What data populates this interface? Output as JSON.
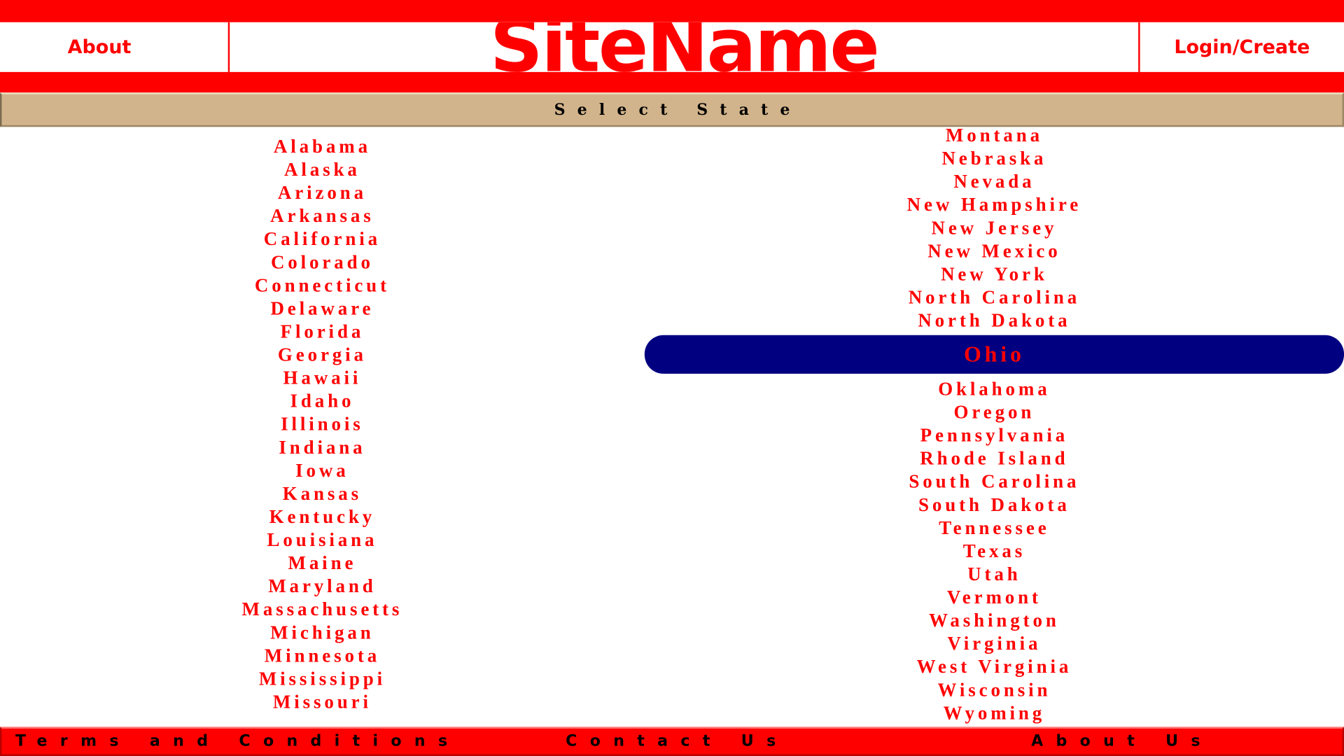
{
  "header": {
    "about_label": "About",
    "site_name": "SiteName",
    "login_label": "Login/Create"
  },
  "select_bar": {
    "label": "Select State"
  },
  "states": {
    "left": [
      "Alabama",
      "Alaska",
      "Arizona",
      "Arkansas",
      "California",
      "Colorado",
      "Connecticut",
      "Delaware",
      "Florida",
      "Georgia",
      "Hawaii",
      "Idaho",
      "Illinois",
      "Indiana",
      "Iowa",
      "Kansas",
      "Kentucky",
      "Louisiana",
      "Maine",
      "Maryland",
      "Massachusetts",
      "Michigan",
      "Minnesota",
      "Mississippi",
      "Missouri"
    ],
    "right_above": [
      "Montana",
      "Nebraska",
      "Nevada",
      "New Hampshire",
      "New Jersey",
      "New Mexico",
      "New York",
      "North Carolina",
      "North Dakota"
    ],
    "selected": "Ohio",
    "right_below": [
      "Oklahoma",
      "Oregon",
      "Pennsylvania",
      "Rhode Island",
      "South Carolina",
      "South Dakota",
      "Tennessee",
      "Texas",
      "Utah",
      "Vermont",
      "Washington",
      "Virginia",
      "West Virginia",
      "Wisconsin",
      "Wyoming"
    ]
  },
  "footer": {
    "terms_label": "Terms and Conditions",
    "contact_label": "Contact Us",
    "about_us_label": "About Us"
  },
  "colors": {
    "brand_red": "#ff0000",
    "select_bar_tan": "#d2b48c",
    "selected_navy": "#000080"
  }
}
